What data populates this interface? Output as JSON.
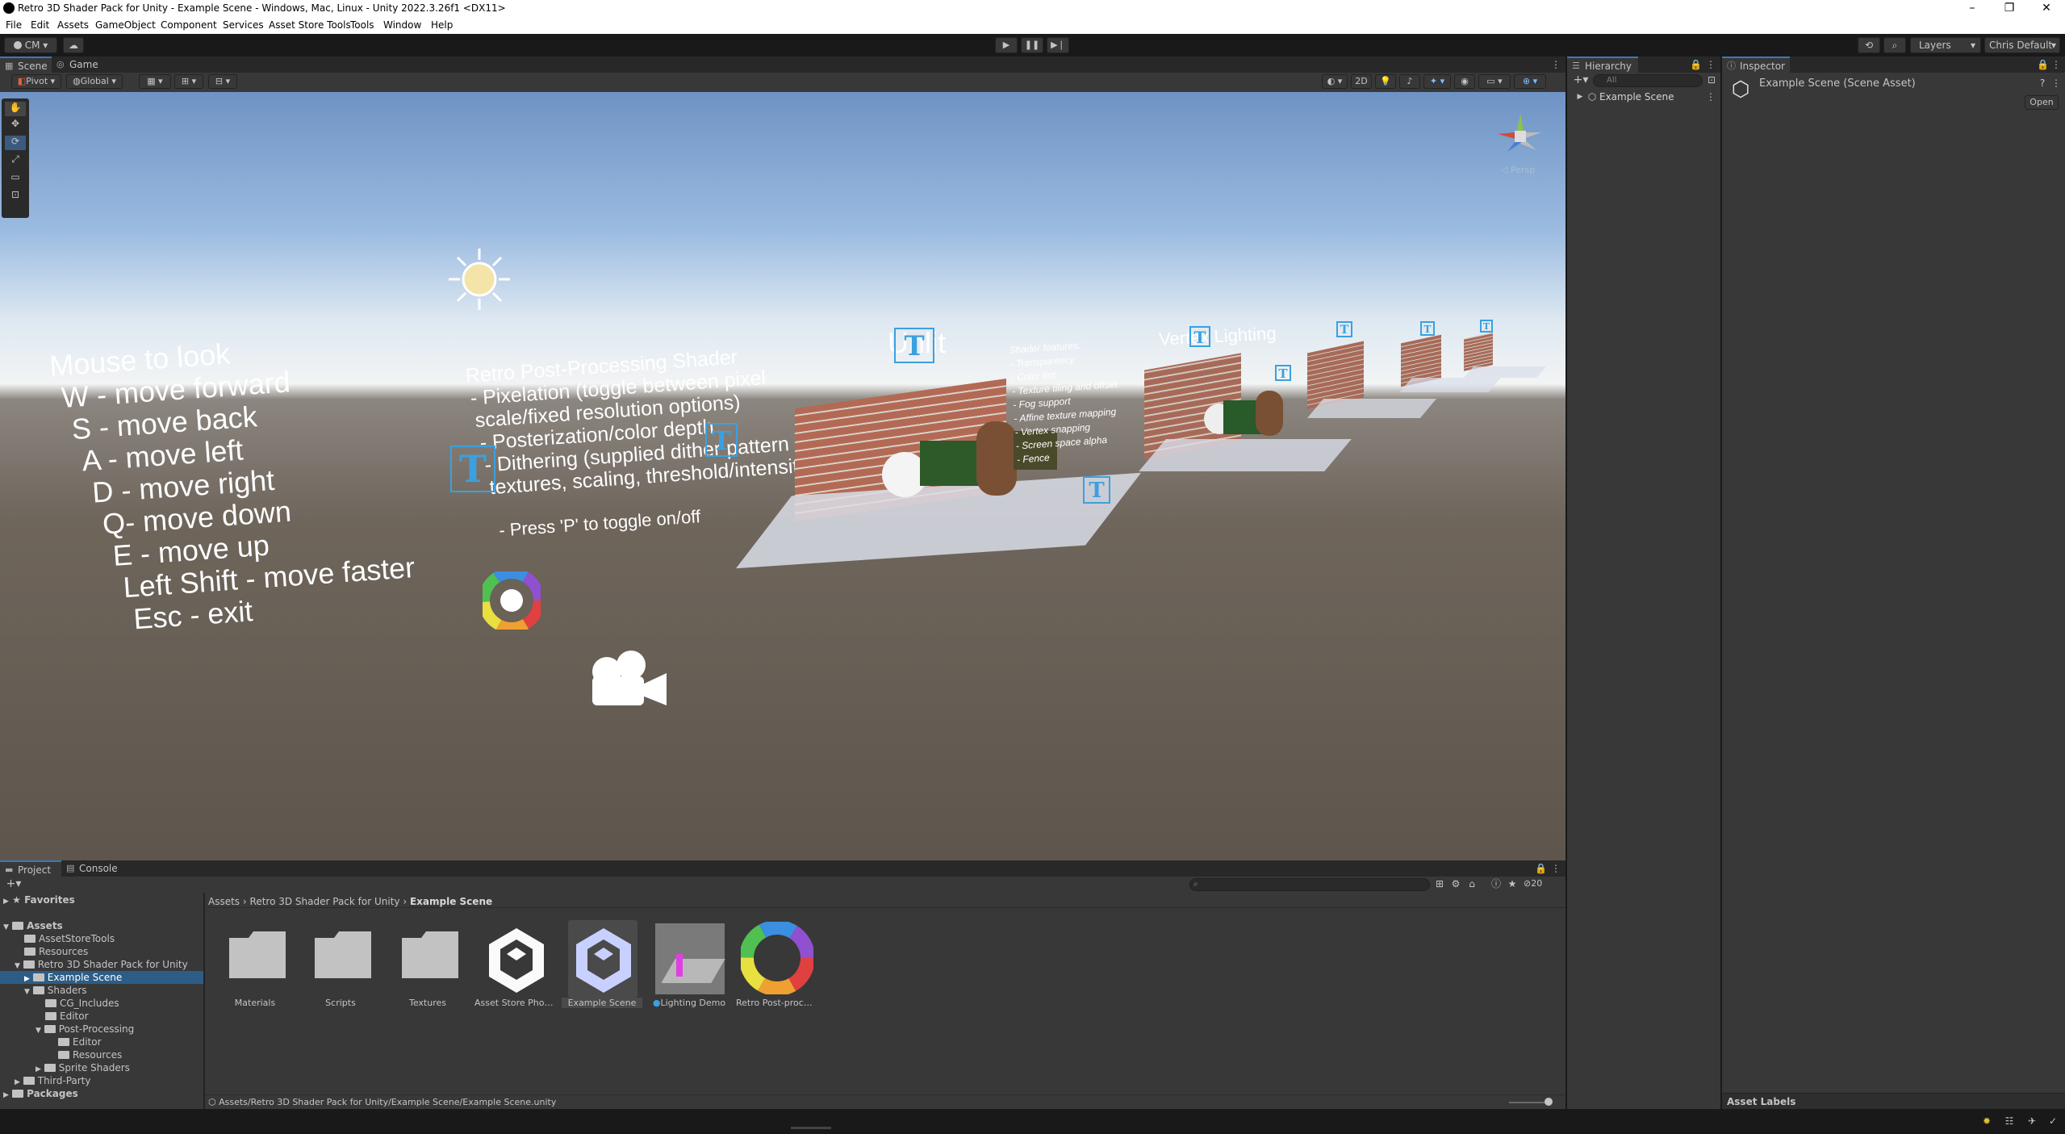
{
  "window": {
    "title": "Retro 3D Shader Pack for Unity - Example Scene - Windows, Mac, Linux - Unity 2022.3.26f1 <DX11>",
    "controls": [
      "–",
      "❐",
      "✕"
    ]
  },
  "menu": [
    "File",
    "Edit",
    "Assets",
    "GameObject",
    "Component",
    "Services",
    "Asset Store Tools",
    "Tools",
    "Window",
    "Help"
  ],
  "toolbar": {
    "account": "CM",
    "layers": "Layers",
    "layout": "Chris Default",
    "play_icon": "play-icon",
    "pause_icon": "pause-icon",
    "step_icon": "step-icon"
  },
  "scene": {
    "tabs": [
      "Scene",
      "Game"
    ],
    "pivot": "Pivot",
    "global": "Global",
    "mode_2d": "2D",
    "persp": "◁ Persp",
    "controls_text": [
      "Mouse to look",
      "W - move forward",
      "S - move back",
      "A - move left",
      "D - move right",
      "Q- move down",
      "E - move up",
      "Left Shift - move faster",
      "Esc - exit"
    ],
    "post_text": [
      "Retro Post-Processing Shader",
      "- Pixelation (toggle between pixel",
      "scale/fixed resolution options)",
      "- Posterization/color depth",
      "- Dithering (supplied dither pattern",
      "textures, scaling, threshold/intensity)",
      "- Press 'P' to toggle on/off"
    ],
    "unlit_label": "Unlit",
    "vertex_label": "Vertex Lighting",
    "features_text": [
      "Shader features:",
      "- Transparency",
      "- Color tint",
      "- Texture tiling and offset",
      "- Fog support",
      "- Affine texture mapping",
      "- Vertex snapping",
      "- Screen space alpha",
      "- Fence"
    ]
  },
  "hierarchy": {
    "tab": "Hierarchy",
    "search_placeholder": "All",
    "root": "Example Scene"
  },
  "inspector": {
    "tab": "Inspector",
    "asset_title": "Example Scene (Scene Asset)",
    "open_button": "Open",
    "asset_labels": "Asset Labels"
  },
  "project": {
    "tabs": [
      "Project",
      "Console"
    ],
    "search_count": "20",
    "breadcrumb": [
      "Assets",
      "Retro 3D Shader Pack for Unity",
      "Example Scene"
    ],
    "tree": {
      "favorites": "Favorites",
      "assets": "Assets",
      "items": [
        "AssetStoreTools",
        "Resources",
        "Retro 3D Shader Pack for Unity",
        "Example Scene",
        "Shaders",
        "CG_Includes",
        "Editor",
        "Post-Processing",
        "Editor",
        "Resources",
        "Sprite Shaders",
        "Third-Party"
      ],
      "packages": "Packages"
    },
    "assets": [
      "Materials",
      "Scripts",
      "Textures",
      "Asset Store Phot...",
      "Example Scene",
      "Lighting Demo",
      "Retro Post-proce..."
    ],
    "status_path": "Assets/Retro 3D Shader Pack for Unity/Example Scene/Example Scene.unity"
  }
}
